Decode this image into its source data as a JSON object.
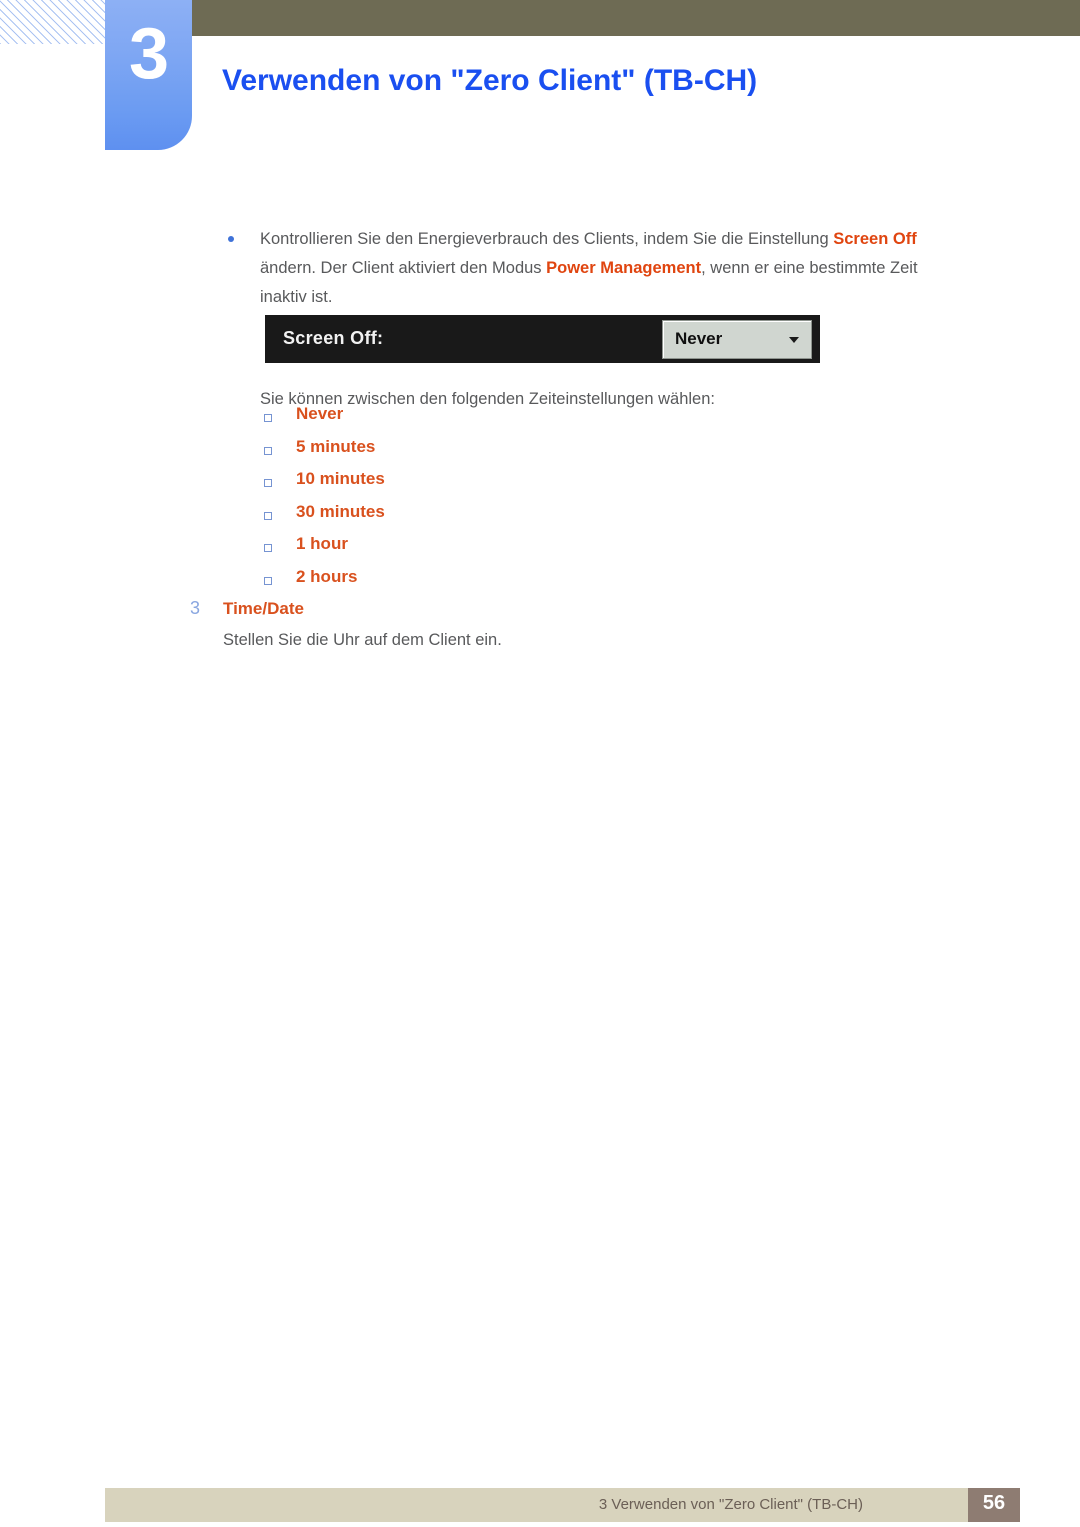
{
  "header": {
    "chapter_number": "3",
    "title": "Verwenden von \"Zero Client\" (TB-CH)",
    "title_color": "#1a4ff0",
    "tab_color": "#6b9bf2",
    "bar_color": "#6e6b54"
  },
  "content": {
    "bullet": {
      "marker": "dot-bullet",
      "text_part1": "Kontrollieren Sie den Energieverbrauch des Clients, indem Sie die Einstellung ",
      "keyword1": "Screen Off",
      "text_part2": " ändern. Der Client aktiviert den Modus ",
      "keyword2": "Power Management",
      "text_part3": ", wenn er eine bestimmte Zeit inaktiv ist."
    },
    "widget": {
      "label": "Screen Off:",
      "selected_value": "Never",
      "caret": "chevron-down-icon",
      "panel_bg": "#191919",
      "select_bg": "#d0d6d0"
    },
    "intro_line": "Sie können zwischen den folgenden Zeiteinstellungen wählen:",
    "options": [
      {
        "label": "Never"
      },
      {
        "label": "5 minutes"
      },
      {
        "label": "10 minutes"
      },
      {
        "label": "30 minutes"
      },
      {
        "label": "1 hour"
      },
      {
        "label": "2 hours"
      }
    ],
    "option_color": "#d9511e",
    "step": {
      "number": "3",
      "title": "Time/Date",
      "description": "Stellen Sie die Uhr auf dem Client ein."
    }
  },
  "footer": {
    "text": "3 Verwenden von \"Zero Client\" (TB-CH)",
    "page_number": "56",
    "bar_color": "#d8d3bd",
    "page_box_color": "#8e7c72"
  }
}
